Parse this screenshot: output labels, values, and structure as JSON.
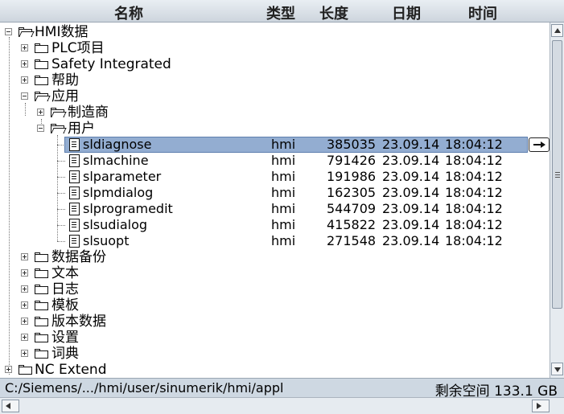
{
  "header": {
    "name": "名称",
    "type": "类型",
    "length": "长度",
    "date": "日期",
    "time": "时间"
  },
  "tree": {
    "root": "HMI数据",
    "plc": "PLC项目",
    "safety": "Safety Integrated",
    "help": "帮助",
    "app": "应用",
    "manufacturer": "制造商",
    "user": "用户",
    "files": [
      {
        "name": "sldiagnose",
        "type": "hmi",
        "length": "385035",
        "date": "23.09.14",
        "time": "18:04:12"
      },
      {
        "name": "slmachine",
        "type": "hmi",
        "length": "791426",
        "date": "23.09.14",
        "time": "18:04:12"
      },
      {
        "name": "slparameter",
        "type": "hmi",
        "length": "191986",
        "date": "23.09.14",
        "time": "18:04:12"
      },
      {
        "name": "slpmdialog",
        "type": "hmi",
        "length": "162305",
        "date": "23.09.14",
        "time": "18:04:12"
      },
      {
        "name": "slprogramedit",
        "type": "hmi",
        "length": "544709",
        "date": "23.09.14",
        "time": "18:04:12"
      },
      {
        "name": "slsudialog",
        "type": "hmi",
        "length": "415822",
        "date": "23.09.14",
        "time": "18:04:12"
      },
      {
        "name": "slsuopt",
        "type": "hmi",
        "length": "271548",
        "date": "23.09.14",
        "time": "18:04:12"
      }
    ],
    "backup": "数据备份",
    "text": "文本",
    "log": "日志",
    "template": "模板",
    "version": "版本数据",
    "settings": "设置",
    "dictionary": "词典",
    "nc_extend": "NC Extend",
    "partial": "数据"
  },
  "status": {
    "path": "C:/Siemens/.../hmi/user/sinumerik/hmi/appl",
    "free_space": "剩余空间 133.1 GB"
  },
  "colors": {
    "selection": "#93add1",
    "header": "#d7dee5",
    "statusbar": "#ced8e2"
  }
}
